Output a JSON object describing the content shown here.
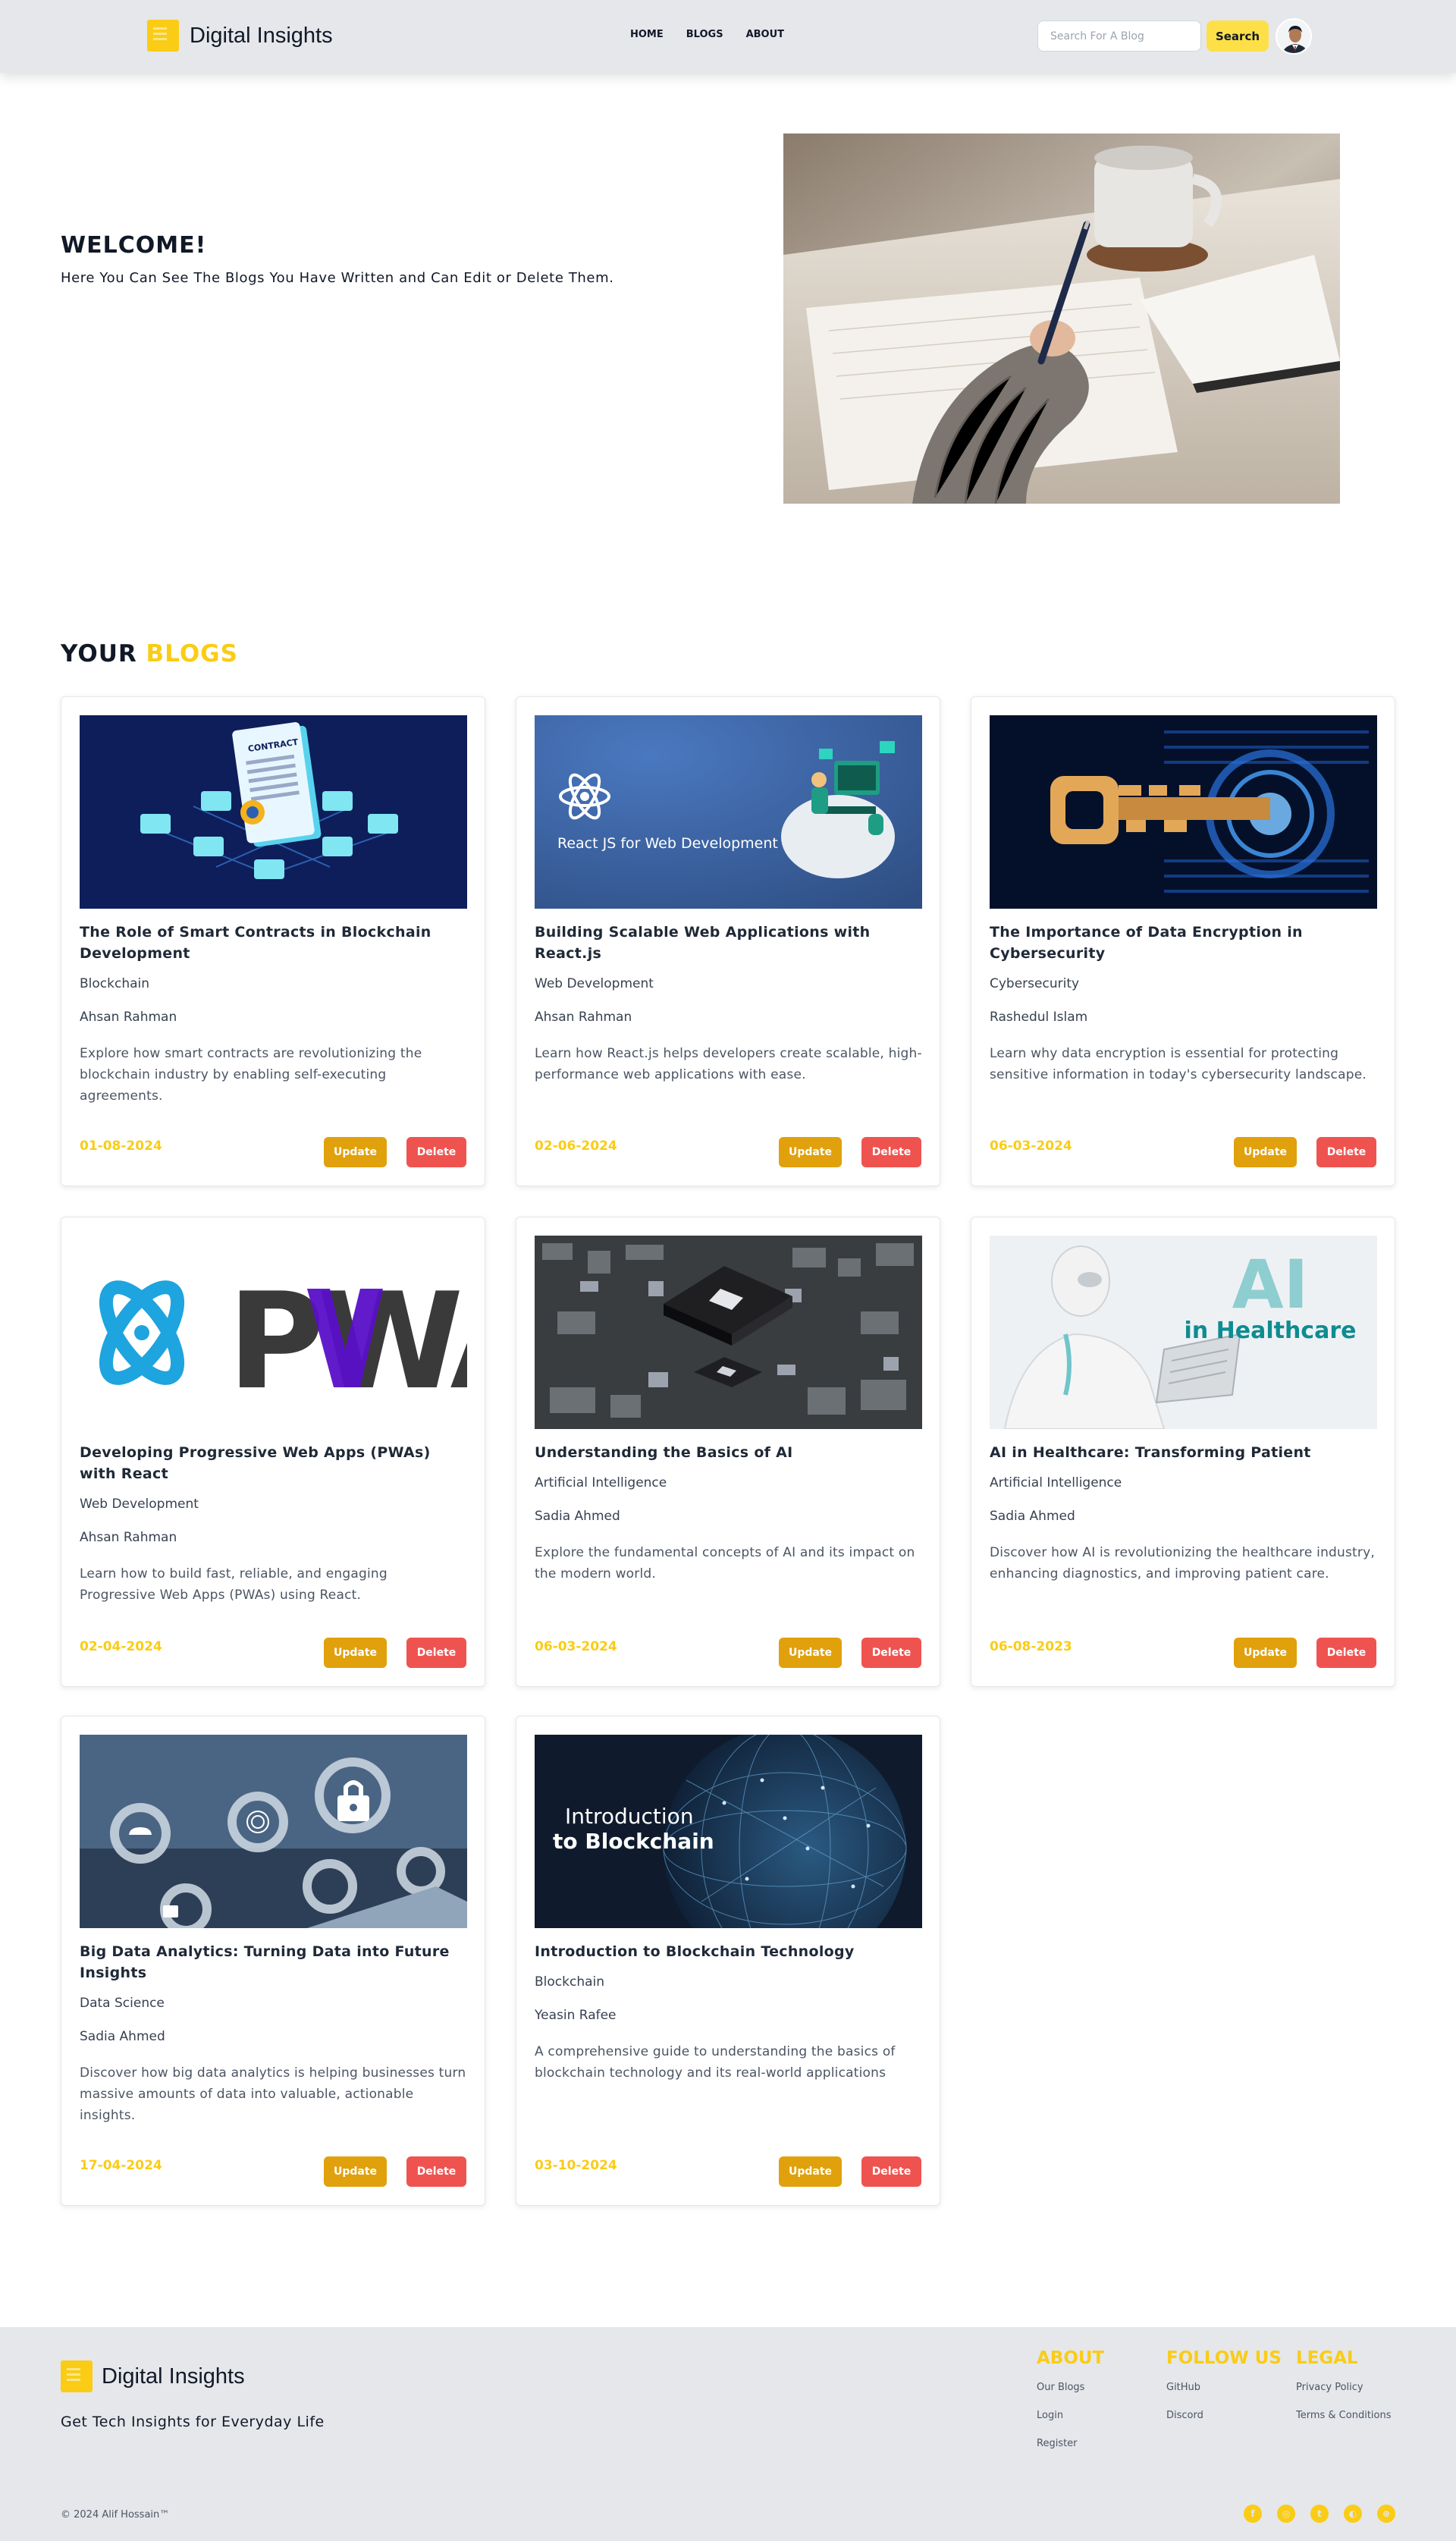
{
  "nav": {
    "brand": "Digital Insights",
    "links": [
      "HOME",
      "BLOGS",
      "ABOUT"
    ],
    "search_placeholder": "Search For A Blog",
    "search_label": "Search"
  },
  "hero": {
    "heading": "WELCOME!",
    "subheading": "Here You Can See The Blogs You Have Written and Can Edit or Delete Them."
  },
  "blogs": {
    "title_plain": "YOUR",
    "title_accent": "BLOGS",
    "update_label": "Update",
    "delete_label": "Delete",
    "items": [
      {
        "title": "The Role of Smart Contracts in Blockchain Development",
        "category": "Blockchain",
        "author": "Ahsan Rahman",
        "description": "Explore how smart contracts are revolutionizing the blockchain industry by enabling self-executing agreements.",
        "date": "01-08-2024"
      },
      {
        "title": "Building Scalable Web Applications with React.js",
        "category": "Web Development",
        "author": "Ahsan Rahman",
        "description": "Learn how React.js helps developers create scalable, high-performance web applications with ease.",
        "date": "02-06-2024",
        "image_text": "React JS for Web Development"
      },
      {
        "title": "The Importance of Data Encryption in Cybersecurity",
        "category": "Cybersecurity",
        "author": "Rashedul Islam",
        "description": "Learn why data encryption is essential for protecting sensitive information in today's cybersecurity landscape.",
        "date": "06-03-2024"
      },
      {
        "title": "Developing Progressive Web Apps (PWAs) with React",
        "category": "Web Development",
        "author": "Ahsan Rahman",
        "description": "Learn how to build fast, reliable, and engaging Progressive Web Apps (PWAs) using React.",
        "date": "02-04-2024",
        "image_text": "PWA"
      },
      {
        "title": "Understanding the Basics of AI",
        "category": "Artificial Intelligence",
        "author": "Sadia Ahmed",
        "description": "Explore the fundamental concepts of AI and its impact on the modern world.",
        "date": "06-03-2024"
      },
      {
        "title": "AI in Healthcare: Transforming Patient",
        "category": "Artificial Intelligence",
        "author": "Sadia Ahmed",
        "description": "Discover how AI is revolutionizing the healthcare industry, enhancing diagnostics, and improving patient care.",
        "date": "06-08-2023",
        "image_text_1": "AI",
        "image_text_2": "in Healthcare"
      },
      {
        "title": "Big Data Analytics: Turning Data into Future Insights",
        "category": "Data Science",
        "author": "Sadia Ahmed",
        "description": "Discover how big data analytics is helping businesses turn massive amounts of data into valuable, actionable insights.",
        "date": "17-04-2024"
      },
      {
        "title": "Introduction to Blockchain Technology",
        "category": "Blockchain",
        "author": "Yeasin Rafee",
        "description": "A comprehensive guide to understanding the basics of blockchain technology and its real-world applications",
        "date": "03-10-2024",
        "image_text_1": "Introduction",
        "image_text_2": "to Blockchain"
      }
    ]
  },
  "footer": {
    "brand": "Digital Insights",
    "tagline": "Get Tech Insights for Everyday Life",
    "columns": [
      {
        "title": "ABOUT",
        "links": [
          "Our Blogs",
          "Login",
          "Register"
        ]
      },
      {
        "title": "FOLLOW US",
        "links": [
          "GitHub",
          "Discord"
        ]
      },
      {
        "title": "LEGAL",
        "links": [
          "Privacy Policy",
          "Terms & Conditions"
        ]
      }
    ],
    "copyright": "© 2024 Alif Hossain™",
    "social_icons": [
      "facebook-icon",
      "instagram-icon",
      "twitter-icon",
      "github-icon",
      "dribbble-icon"
    ],
    "accent_color": "#facc15"
  }
}
